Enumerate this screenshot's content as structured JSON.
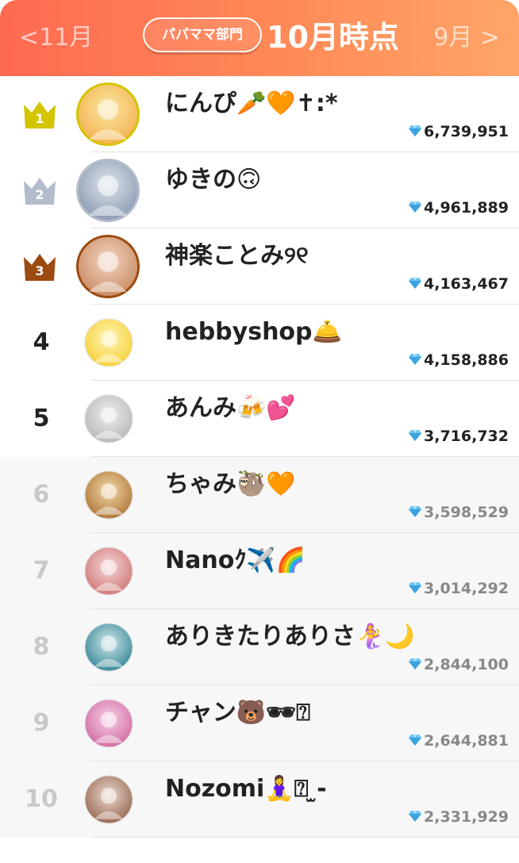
{
  "header": {
    "prev_label": "<11月",
    "next_label": "9月 >",
    "category_label": "パパママ部門",
    "title": "10月時点"
  },
  "colors": {
    "header_gradient_start": "#ff6a52",
    "header_gradient_end": "#ffa567",
    "gold": "#d4c400",
    "silver": "#b4bccb",
    "bronze": "#9b4a10",
    "rank_dim": "#c9c9c9"
  },
  "icons": {
    "score_icon": "diamond-icon",
    "crown_icon": "crown-icon"
  },
  "entries": [
    {
      "rank": "1",
      "name": "にんぴ🥕🧡✝︎:*",
      "score": "6,739,951",
      "crown": "gold"
    },
    {
      "rank": "2",
      "name": "ゆきの🙃",
      "score": "4,961,889",
      "crown": "silver"
    },
    {
      "rank": "3",
      "name": "神楽ことみ୨୧",
      "score": "4,163,467",
      "crown": "bronze"
    },
    {
      "rank": "4",
      "name": "hebbyshop🛎️",
      "score": "4,158,886"
    },
    {
      "rank": "5",
      "name": "あんみ🍻💕",
      "score": "3,716,732"
    },
    {
      "rank": "6",
      "name": "ちゃみ🦥🧡",
      "score": "3,598,529"
    },
    {
      "rank": "7",
      "name": "Nanoｸ✈️🌈",
      "score": "3,014,292"
    },
    {
      "rank": "8",
      "name": "ありきたりありさ🧜‍♀️🌙",
      "score": "2,844,100"
    },
    {
      "rank": "9",
      "name": "チャン🐻🕶⍰",
      "score": "2,644,881"
    },
    {
      "rank": "10",
      "name": "Nozomi🧘‍♀️⍰ ̫-",
      "score": "2,331,929"
    }
  ]
}
